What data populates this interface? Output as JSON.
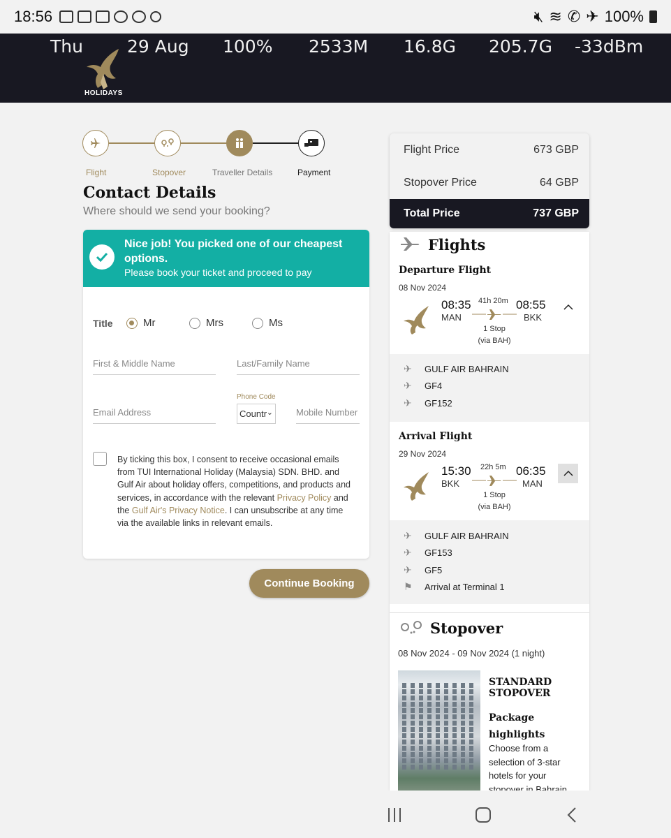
{
  "status_bar": {
    "time": "18:56",
    "battery": "100%"
  },
  "header": {
    "stats": [
      "Thu",
      "29 Aug",
      "100%",
      "2533M",
      "16.8G",
      "205.7G",
      "-33dBm"
    ],
    "logo_text": "HOLIDAYS",
    "background_color": "#181822"
  },
  "steps": [
    {
      "label": "Flight",
      "icon": "airplane-icon",
      "state": "done"
    },
    {
      "label": "Stopover",
      "icon": "map-pin-icon",
      "state": "done"
    },
    {
      "label": "Traveller Details",
      "icon": "travellers-icon",
      "state": "active"
    },
    {
      "label": "Payment",
      "icon": "payment-icon",
      "state": "pending"
    }
  ],
  "contact": {
    "title": "Contact Details",
    "subtitle": "Where should we send your booking?",
    "banner_title": "Nice job! You picked one of our cheapest options.",
    "banner_sub": "Please book your ticket and proceed to pay",
    "title_label": "Title",
    "title_options": [
      "Mr",
      "Mrs",
      "Ms"
    ],
    "selected_title": "Mr",
    "first_name_placeholder": "First & Middle Name",
    "last_name_placeholder": "Last/Family Name",
    "email_placeholder": "Email Address",
    "phone_code_label": "Phone Code",
    "phone_code_value": "Countr",
    "mobile_placeholder": "Mobile Number",
    "consent_part1": "By ticking this box, I consent to receive occasional emails from TUI International Holiday (Malaysia) SDN. BHD. and Gulf Air about holiday offers, competitions, and products and services, in accordance with the relevant ",
    "consent_link1": "Privacy Policy",
    "consent_part2": " and the ",
    "consent_link2": "Gulf Air's Privacy Notice",
    "consent_part3": ". I can unsubscribe at any time via the available links in relevant emails.",
    "continue_label": "Continue Booking"
  },
  "prices": {
    "flight_label": "Flight Price",
    "flight_value": "673 GBP",
    "stopover_label": "Stopover Price",
    "stopover_value": "64 GBP",
    "total_label": "Total Price",
    "total_value": "737 GBP"
  },
  "flights": {
    "title": "Flights",
    "departure": {
      "heading": "Departure Flight",
      "date": "08 Nov 2024",
      "dep_time": "08:35",
      "dep_code": "MAN",
      "arr_time": "08:55",
      "arr_code": "BKK",
      "duration": "41h 20m",
      "stops": "1 Stop",
      "via": "(via BAH)",
      "details": [
        "GULF AIR BAHRAIN",
        "GF4",
        "GF152"
      ]
    },
    "arrival": {
      "heading": "Arrival Flight",
      "date": "29 Nov 2024",
      "dep_time": "15:30",
      "dep_code": "BKK",
      "arr_time": "06:35",
      "arr_code": "MAN",
      "duration": "22h 5m",
      "stops": "1 Stop",
      "via": "(via BAH)",
      "details": [
        "GULF AIR BAHRAIN",
        "GF153",
        "GF5",
        "Arrival at Terminal 1"
      ]
    }
  },
  "stopover": {
    "title": "Stopover",
    "dates": "08 Nov 2024 - 09 Nov 2024 (1 night)",
    "package_title": "STANDARD STOPOVER",
    "highlights_heading": "Package highlights",
    "highlights_text": "Choose from a selection of 3-star hotels for your stopover in Bahrain"
  },
  "colors": {
    "accent_gold": "#a08a5c",
    "teal_banner": "#13afa4",
    "dark": "#181822"
  }
}
